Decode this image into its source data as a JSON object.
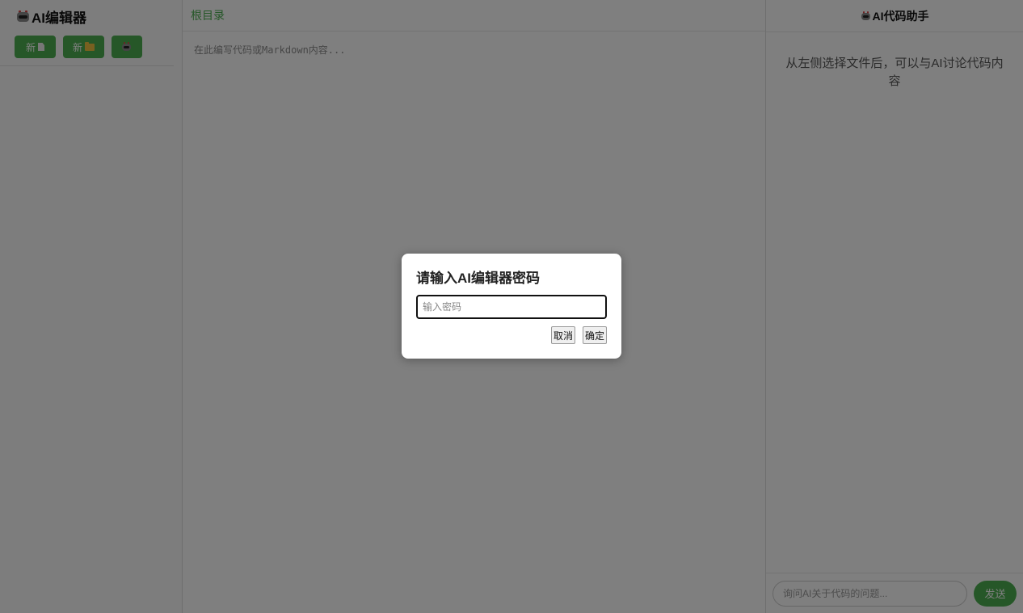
{
  "sidebar": {
    "title": "AI编辑器",
    "title_icon": "robot-icon",
    "buttons": [
      {
        "label": "新",
        "icon": "file-icon"
      },
      {
        "label": "新",
        "icon": "folder-icon"
      },
      {
        "label": "",
        "icon": "robot-icon"
      }
    ]
  },
  "editor": {
    "breadcrumb": "根目录",
    "placeholder": "在此编写代码或Markdown内容..."
  },
  "ai_panel": {
    "title": "AI代码助手",
    "title_icon": "robot-icon",
    "empty_message": "从左侧选择文件后，可以与AI讨论代码内容",
    "input_placeholder": "询问AI关于代码的问题...",
    "send_label": "发送"
  },
  "modal": {
    "title": "请输入AI编辑器密码",
    "input_placeholder": "输入密码",
    "cancel_label": "取消",
    "confirm_label": "确定"
  },
  "colors": {
    "accent": "#4caf50",
    "overlay": "rgba(0,0,0,0.5)"
  }
}
